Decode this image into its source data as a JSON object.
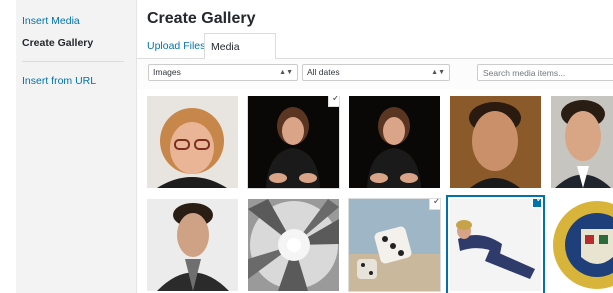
{
  "sidebar": {
    "items": [
      {
        "label": "Insert Media"
      },
      {
        "label": "Create Gallery"
      },
      {
        "label": "Insert from URL"
      }
    ]
  },
  "header": {
    "title": "Create Gallery"
  },
  "tabs": [
    {
      "label": "Upload Files"
    },
    {
      "label": "Media Library"
    }
  ],
  "filters": {
    "type_selected": "Images",
    "date_selected": "All dates",
    "search_placeholder": "Search media items..."
  },
  "colors": {
    "accent": "#0073aa",
    "link": "#0073aa"
  },
  "media_items": [
    {
      "name": "woman-red-hair-glasses",
      "state": "none"
    },
    {
      "name": "older-woman-black-sweater",
      "state": "checked"
    },
    {
      "name": "older-woman-black-sweater",
      "state": "none"
    },
    {
      "name": "man-dark-hair",
      "state": "none"
    },
    {
      "name": "man-dark-hair-suit",
      "state": "none"
    },
    {
      "name": "man-dark-hair-jacket",
      "state": "none"
    },
    {
      "name": "spiral-tunnel",
      "state": "none"
    },
    {
      "name": "dice",
      "state": "checked"
    },
    {
      "name": "man-lying-suit",
      "state": "selected"
    },
    {
      "name": "crest-seal",
      "state": "none"
    }
  ]
}
